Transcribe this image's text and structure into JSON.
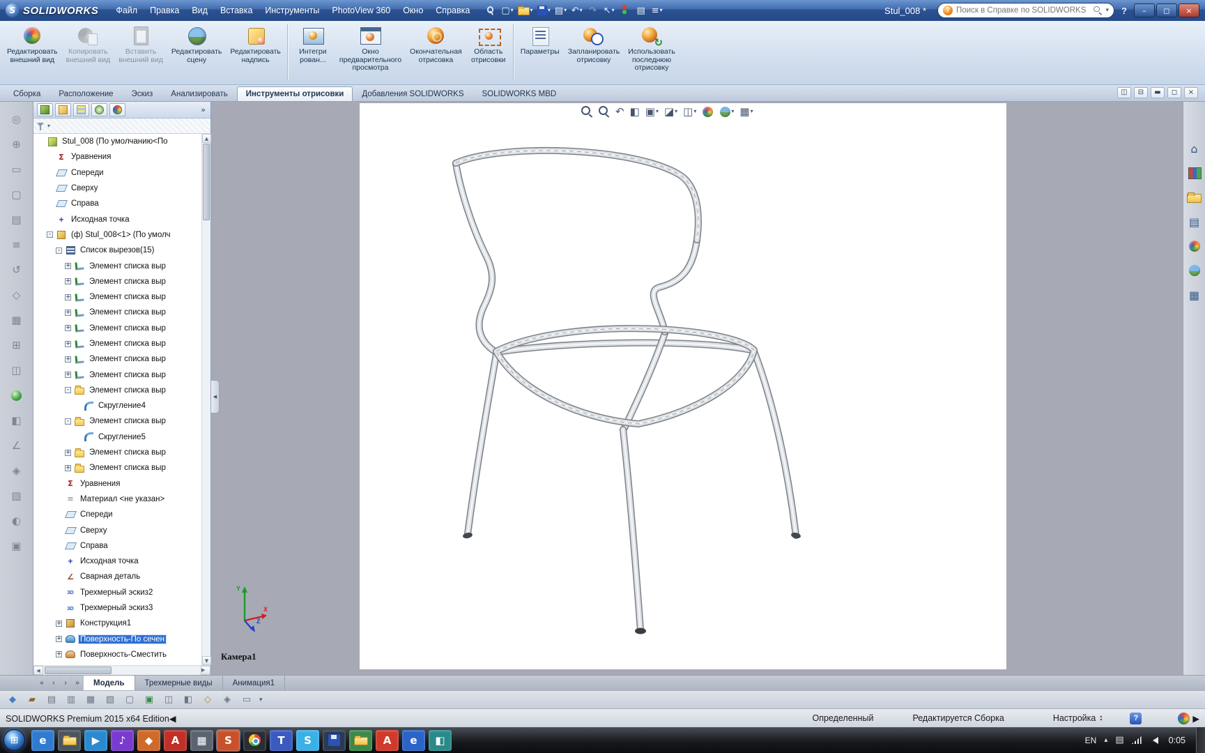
{
  "titlebar": {
    "logo_glyph": "S",
    "brand": "SOLIDWORKS",
    "menus": [
      "Файл",
      "Правка",
      "Вид",
      "Вставка",
      "Инструменты",
      "PhotoView 360",
      "Окно",
      "Справка"
    ],
    "quick_icons": [
      {
        "name": "pin-menu-icon",
        "kind": "pin"
      },
      {
        "name": "new-document-icon",
        "glyph": "▢",
        "dd": true
      },
      {
        "name": "open-document-icon",
        "kind": "folder",
        "dd": true
      },
      {
        "name": "save-icon",
        "kind": "floppy",
        "dd": true
      },
      {
        "name": "print-icon",
        "glyph": "▤",
        "dd": true
      },
      {
        "name": "undo-icon",
        "glyph": "↶",
        "dd": true
      },
      {
        "name": "redo-icon",
        "glyph": "↷",
        "disabled": true
      },
      {
        "name": "select-arrow-icon",
        "glyph": "↖",
        "dd": true
      },
      {
        "name": "rebuild-icon",
        "kind": "traffic"
      },
      {
        "name": "file-properties-icon",
        "glyph": "▤"
      },
      {
        "name": "options-icon",
        "glyph": "≡",
        "dd": true
      }
    ],
    "document_title": "Stul_008 *",
    "search": {
      "placeholder": "Поиск в Справке по SOLIDWORKS",
      "help_glyph": "?"
    },
    "help_glyph": "?",
    "window_buttons": [
      {
        "name": "minimize-button",
        "glyph": "–"
      },
      {
        "name": "maximize-button",
        "glyph": "◻"
      },
      {
        "name": "close-button",
        "glyph": "×",
        "close": true
      }
    ]
  },
  "ribbon": {
    "buttons": [
      {
        "label": "Редактировать\nвнешний вид",
        "icon": "edit-appearance-icon"
      },
      {
        "label": "Копировать\nвнешний вид",
        "icon": "copy-appearance-icon",
        "disabled": true
      },
      {
        "label": "Вставить\nвнешний вид",
        "icon": "paste-appearance-icon",
        "disabled": true
      },
      {
        "label": "Редактировать\nсцену",
        "icon": "edit-scene-icon"
      },
      {
        "label": "Редактировать\nнадпись",
        "icon": "edit-decal-icon",
        "sep_after": true
      },
      {
        "label": "Интегри\nрован...",
        "icon": "integrated-preview-icon"
      },
      {
        "label": "Окно\nпредварительного\nпросмотра",
        "icon": "preview-window-icon"
      },
      {
        "label": "Окончательная\nотрисовка",
        "icon": "final-render-icon"
      },
      {
        "label": "Область\nотрисовки",
        "icon": "render-region-icon",
        "sep_after": true
      },
      {
        "label": "Параметры",
        "icon": "options-icon"
      },
      {
        "label": "Запланировать\nотрисовку",
        "icon": "schedule-render-icon"
      },
      {
        "label": "Использовать\nпоследнюю\nотрисовку",
        "icon": "use-last-render-icon"
      }
    ]
  },
  "command_tabs": {
    "items": [
      {
        "label": "Сборка"
      },
      {
        "label": "Расположение"
      },
      {
        "label": "Эскиз"
      },
      {
        "label": "Анализировать"
      },
      {
        "label": "Инструменты отрисовки",
        "active": true
      },
      {
        "label": "Добавления SOLIDWORKS"
      },
      {
        "label": "SOLIDWORKS MBD"
      }
    ],
    "window_controls": [
      {
        "name": "viewport-layout-icon",
        "glyph": "◫"
      },
      {
        "name": "viewport-layout-2-icon",
        "glyph": "⊟"
      },
      {
        "name": "doc-minimize-icon",
        "glyph": "▬"
      },
      {
        "name": "doc-restore-icon",
        "glyph": "◻"
      },
      {
        "name": "doc-close-icon",
        "glyph": "×"
      }
    ]
  },
  "left_toolbar": {
    "icons": [
      {
        "name": "left-toolbar-icon",
        "glyph": "◎"
      },
      {
        "name": "left-toolbar-icon",
        "glyph": "⊕"
      },
      {
        "name": "left-toolbar-icon",
        "glyph": "▭"
      },
      {
        "name": "left-toolbar-icon",
        "glyph": "▢"
      },
      {
        "name": "left-toolbar-icon",
        "glyph": "▤"
      },
      {
        "name": "left-toolbar-icon",
        "glyph": "≡"
      },
      {
        "name": "left-toolbar-icon",
        "glyph": "↺"
      },
      {
        "name": "left-toolbar-icon",
        "glyph": "◇"
      },
      {
        "name": "left-toolbar-icon",
        "glyph": "▦"
      },
      {
        "name": "left-toolbar-icon",
        "glyph": "⊞"
      },
      {
        "name": "left-toolbar-icon",
        "glyph": "◫"
      },
      {
        "name": "left-toolbar-icon",
        "kind": "ball-green"
      },
      {
        "name": "left-toolbar-icon",
        "glyph": "◧"
      },
      {
        "name": "left-toolbar-icon",
        "glyph": "∠"
      },
      {
        "name": "left-toolbar-icon",
        "glyph": "◈"
      },
      {
        "name": "left-toolbar-icon",
        "glyph": "▧"
      },
      {
        "name": "left-toolbar-icon",
        "glyph": "◐"
      },
      {
        "name": "left-toolbar-icon",
        "glyph": "▣"
      }
    ]
  },
  "feature_tree": {
    "manager_tabs": [
      {
        "name": "featuremanager-tab-icon"
      },
      {
        "name": "propertymanager-tab-icon"
      },
      {
        "name": "configurationmanager-tab-icon"
      },
      {
        "name": "dimxpertmanager-tab-icon"
      },
      {
        "name": "displaymanager-tab-icon"
      }
    ],
    "overflow_glyph": "»",
    "items": [
      {
        "label": "Stul_008  (По умолчанию<По",
        "icon": "assembly-icon",
        "level": 0
      },
      {
        "label": "Уравнения",
        "icon": "equations-icon",
        "level": 1
      },
      {
        "label": "Спереди",
        "icon": "plane-icon",
        "level": 1
      },
      {
        "label": "Сверху",
        "icon": "plane-icon",
        "level": 1
      },
      {
        "label": "Справа",
        "icon": "plane-icon",
        "level": 1
      },
      {
        "label": "Исходная точка",
        "icon": "origin-icon",
        "level": 1
      },
      {
        "label": "(ф) Stul_008<1> (По умолч",
        "icon": "part-icon",
        "level": 1,
        "expand": "-"
      },
      {
        "label": "Список вырезов(15)",
        "icon": "cutlist-icon",
        "level": 2,
        "expand": "-"
      },
      {
        "label": "Элемент списка выр",
        "icon": "weld-item-icon",
        "level": 3,
        "expand": "+"
      },
      {
        "label": "Элемент списка выр",
        "icon": "weld-item-icon",
        "level": 3,
        "expand": "+"
      },
      {
        "label": "Элемент списка выр",
        "icon": "weld-item-icon",
        "level": 3,
        "expand": "+"
      },
      {
        "label": "Элемент списка выр",
        "icon": "weld-item-icon",
        "level": 3,
        "expand": "+"
      },
      {
        "label": "Элемент списка выр",
        "icon": "weld-item-icon",
        "level": 3,
        "expand": "+"
      },
      {
        "label": "Элемент списка выр",
        "icon": "weld-item-icon",
        "level": 3,
        "expand": "+"
      },
      {
        "label": "Элемент списка выр",
        "icon": "weld-item-icon",
        "level": 3,
        "expand": "+"
      },
      {
        "label": "Элемент списка выр",
        "icon": "weld-item-icon",
        "level": 3,
        "expand": "+"
      },
      {
        "label": "Элемент списка выр",
        "icon": "folder-icon",
        "level": 3,
        "expand": "-"
      },
      {
        "label": "Скругление4",
        "icon": "fillet-icon",
        "level": 4
      },
      {
        "label": "Элемент списка выр",
        "icon": "folder-icon",
        "level": 3,
        "expand": "-"
      },
      {
        "label": "Скругление5",
        "icon": "fillet-icon",
        "level": 4
      },
      {
        "label": "Элемент списка выр",
        "icon": "folder-icon",
        "level": 3,
        "expand": "+"
      },
      {
        "label": "Элемент списка выр",
        "icon": "folder-icon",
        "level": 3,
        "expand": "+"
      },
      {
        "label": "Уравнения",
        "icon": "equations-icon",
        "level": 2
      },
      {
        "label": "Материал <не указан>",
        "icon": "material-icon",
        "level": 2
      },
      {
        "label": "Спереди",
        "icon": "plane-icon",
        "level": 2
      },
      {
        "label": "Сверху",
        "icon": "plane-icon",
        "level": 2
      },
      {
        "label": "Справа",
        "icon": "plane-icon",
        "level": 2
      },
      {
        "label": "Исходная точка",
        "icon": "origin-icon",
        "level": 2
      },
      {
        "label": "Сварная деталь",
        "icon": "weldment-icon",
        "level": 2
      },
      {
        "label": "Трехмерный эскиз2",
        "icon": "sketch3d-icon",
        "level": 2
      },
      {
        "label": "Трехмерный эскиз3",
        "icon": "sketch3d-icon",
        "level": 2
      },
      {
        "label": "Конструкция1",
        "icon": "construction-icon",
        "level": 2,
        "expand": "+"
      },
      {
        "label": "Поверхность-По сечен",
        "icon": "surface-loft-icon",
        "level": 2,
        "expand": "+",
        "selected": true
      },
      {
        "label": "Поверхность-Сместить",
        "icon": "surface-offset-icon",
        "level": 2,
        "expand": "+"
      }
    ]
  },
  "viewport": {
    "hud_icons": [
      {
        "name": "zoom-fit-icon",
        "kind": "lens"
      },
      {
        "name": "zoom-area-icon",
        "kind": "lens"
      },
      {
        "name": "previous-view-icon",
        "glyph": "↶"
      },
      {
        "name": "section-view-icon",
        "glyph": "◧"
      },
      {
        "name": "view-orientation-icon",
        "glyph": "▣",
        "dd": true
      },
      {
        "name": "display-style-icon",
        "glyph": "◪",
        "dd": true
      },
      {
        "name": "hide-show-items-icon",
        "glyph": "◫",
        "dd": true
      },
      {
        "name": "edit-appearance-hud-icon",
        "kind": "ball-multi"
      },
      {
        "name": "apply-scene-icon",
        "kind": "scene",
        "dd": true
      },
      {
        "name": "view-settings-icon",
        "glyph": "▦",
        "dd": true
      }
    ],
    "camera_label": "Камера1",
    "triad": {
      "x": "X",
      "y": "Y",
      "z": "Z"
    }
  },
  "task_pane": {
    "icons": [
      {
        "name": "home-icon",
        "glyph": "⌂"
      },
      {
        "name": "design-library-icon",
        "kind": "books"
      },
      {
        "name": "file-explorer-icon",
        "kind": "folder"
      },
      {
        "name": "view-palette-icon",
        "glyph": "▤"
      },
      {
        "name": "appearances-icon",
        "kind": "ball-multi"
      },
      {
        "name": "scenes-icon",
        "kind": "scene"
      },
      {
        "name": "custom-properties-icon",
        "glyph": "▦"
      }
    ]
  },
  "model_tabs": {
    "scroll_glyphs": [
      {
        "name": "tab-scroll-first-icon",
        "glyph": "«"
      },
      {
        "name": "tab-scroll-prev-icon",
        "glyph": "‹"
      },
      {
        "name": "tab-scroll-next-icon",
        "glyph": "›"
      },
      {
        "name": "tab-scroll-last-icon",
        "glyph": "»"
      }
    ],
    "items": [
      {
        "label": "Модель",
        "active": true
      },
      {
        "label": "Трехмерные виды"
      },
      {
        "label": "Анимация1"
      }
    ]
  },
  "macro_bar": {
    "icons": [
      {
        "name": "macro-bar-icon",
        "glyph": "◆",
        "color": "#4a7ec2"
      },
      {
        "name": "macro-bar-icon",
        "glyph": "▰",
        "color": "#8a6a2a"
      },
      {
        "name": "macro-bar-icon",
        "glyph": "▤"
      },
      {
        "name": "macro-bar-icon",
        "glyph": "▥"
      },
      {
        "name": "macro-bar-icon",
        "glyph": "▦"
      },
      {
        "name": "macro-bar-icon",
        "glyph": "▧"
      },
      {
        "name": "macro-bar-icon",
        "glyph": "▢"
      },
      {
        "name": "macro-bar-icon",
        "glyph": "▣",
        "color": "#3a8a4a"
      },
      {
        "name": "macro-bar-icon",
        "glyph": "◫"
      },
      {
        "name": "macro-bar-icon",
        "glyph": "◧"
      },
      {
        "name": "macro-bar-icon",
        "glyph": "◇",
        "color": "#b8862a"
      },
      {
        "name": "macro-bar-icon",
        "glyph": "◈"
      },
      {
        "name": "macro-bar-icon",
        "glyph": "▭"
      }
    ],
    "dropdown_glyph": "▾"
  },
  "statusbar": {
    "left_text": "SOLIDWORKS Premium 2015 x64 Edition",
    "state_text": "Определенный",
    "mode_text": "Редактируется Сборка",
    "config_text": "Настройка",
    "help_glyph": "?"
  },
  "taskbar": {
    "start_glyph": "⊞",
    "apps": [
      {
        "name": "taskbar-app-internet-explorer",
        "glyph": "e",
        "color": "#2f7bd0"
      },
      {
        "name": "taskbar-app-file-explorer",
        "kind": "folder",
        "color": "#4a5560"
      },
      {
        "name": "taskbar-app-media-player",
        "glyph": "▶",
        "color": "#2a8ad0"
      },
      {
        "name": "taskbar-app-music",
        "glyph": "♪",
        "color": "#7a3ad0"
      },
      {
        "name": "taskbar-app-photo-viewer",
        "glyph": "◆",
        "color": "#d06a2a"
      },
      {
        "name": "taskbar-app-acrobat",
        "glyph": "A",
        "color": "#c03028"
      },
      {
        "name": "taskbar-app-console",
        "glyph": "▦",
        "color": "#5a6470"
      },
      {
        "name": "taskbar-app-solidworks",
        "glyph": "S",
        "color": "#c8502a",
        "pressed": true
      },
      {
        "name": "taskbar-app-chrome",
        "kind": "chrome",
        "color": "#2a2e34"
      },
      {
        "name": "taskbar-app-commander",
        "glyph": "T",
        "color": "#3a5ac0"
      },
      {
        "name": "taskbar-app-skype",
        "glyph": "S",
        "color": "#3ab0e8"
      },
      {
        "name": "taskbar-app-backup",
        "kind": "floppy",
        "color": "#2a3a50"
      },
      {
        "name": "taskbar-app-documents",
        "kind": "folder",
        "color": "#3a8a4a"
      },
      {
        "name": "taskbar-app-pdf-reader",
        "glyph": "A",
        "color": "#d03a2a"
      },
      {
        "name": "taskbar-app-browser",
        "glyph": "e",
        "color": "#2a64c8"
      },
      {
        "name": "taskbar-app-remote-desktop",
        "glyph": "◧",
        "color": "#2a8a8a"
      }
    ],
    "tray": {
      "language": "EN",
      "expand_glyph": "▴",
      "input_glyph": "▤",
      "clock": "0:05"
    }
  }
}
